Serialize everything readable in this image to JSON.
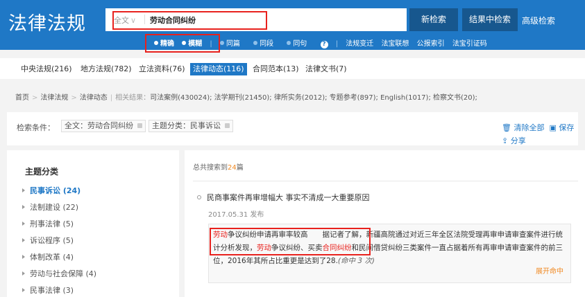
{
  "header": {
    "logo": "法律法规",
    "search_mode": "全文",
    "search_value": "劳动合同纠纷",
    "btn_new": "新检索",
    "btn_within": "结果中检索",
    "advanced": "高级检索"
  },
  "options": {
    "exact": "精确",
    "fuzzy": "模糊",
    "same_article": "同篇",
    "same_paragraph": "同段",
    "same_sentence": "同句",
    "help_icon": "?",
    "links": [
      "法规变迁",
      "法宝联想",
      "公报索引",
      "法宝引证码"
    ]
  },
  "cat_tabs": [
    {
      "label": "中央法规(216)"
    },
    {
      "label": "地方法规(782)"
    },
    {
      "label": "立法资料(76)"
    },
    {
      "label": "法律动态(116)"
    },
    {
      "label": "合同范本(13)"
    },
    {
      "label": "法律文书(7)"
    }
  ],
  "breadcrumb": {
    "path": [
      "首页",
      "法律法规",
      "法律动态"
    ],
    "related_label": "相关结果：",
    "related_text": "司法案例(430024); 法学期刊(21450); 律所实务(2012); 专题参考(897); English(1017); 检察文书(20);"
  },
  "conditions": {
    "label": "检索条件：",
    "tags": [
      "全文：劳动合同纠纷",
      "主题分类：民事诉讼"
    ],
    "clear_all": "清除全部",
    "save": "保存",
    "share": "分享"
  },
  "sidebar": {
    "title": "主题分类",
    "items": [
      {
        "label": "民事诉讼 (24)"
      },
      {
        "label": "法制建设 (22)"
      },
      {
        "label": "刑事法律 (5)"
      },
      {
        "label": "诉讼程序 (5)"
      },
      {
        "label": "体制改革 (4)"
      },
      {
        "label": "劳动与社会保障 (4)"
      },
      {
        "label": "民事法律 (3)"
      }
    ]
  },
  "results": {
    "total_prefix": "总共搜索到",
    "total_count": "24",
    "total_suffix": "篇",
    "item": {
      "title": "民商事案件再审增幅大 事实不清成一大重要原因",
      "date": "2017.05.31 发布",
      "s1": "劳动",
      "s2": "争议纠纷申请再审率较高　　据记者了解，新疆高院通过对近三年全区法院受理再审申请审查案件进行统计分析发现，",
      "s3": "劳动",
      "s4": "争议纠纷、买卖",
      "s5": "合同纠纷",
      "s6": "和民间借贷纠纷三类案件一直占据着所有再审申请审查案件的前三位，2016年其所占比重更是达到了28.",
      "s7": "(命中 3 次)",
      "expand": "展开命中"
    }
  },
  "colors": {
    "brand": "#1f78c6",
    "highlight": "#e8211d",
    "accent": "#f08a24"
  }
}
